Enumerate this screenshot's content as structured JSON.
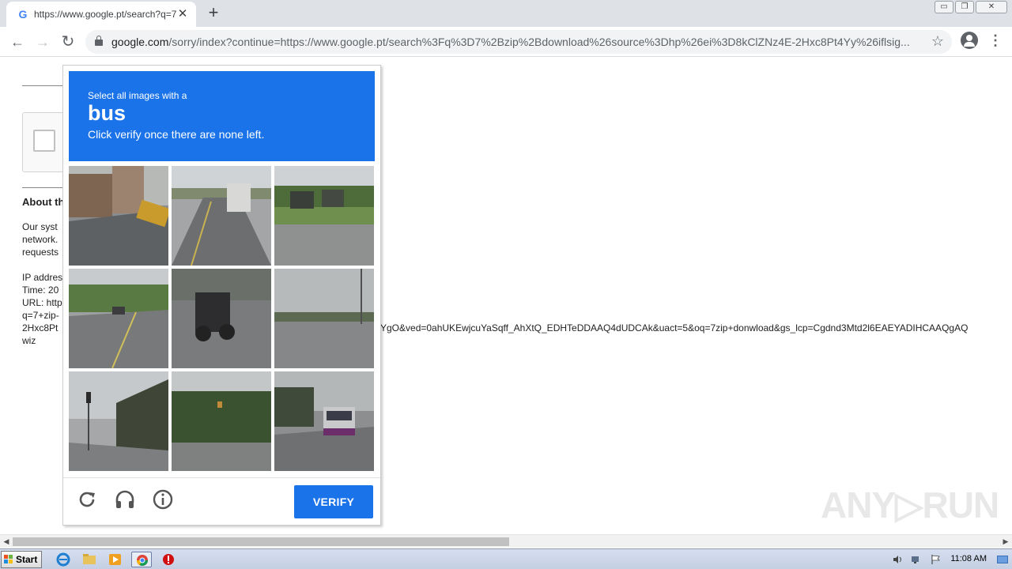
{
  "browser": {
    "tab_title": "https://www.google.pt/search?q=7",
    "tab_favicon": "G",
    "tab_close": "✕",
    "new_tab": "+",
    "win_minimize": "▭",
    "win_restore": "❐",
    "win_close": "✕",
    "back": "←",
    "forward": "→",
    "reload": "↻",
    "url_host": "google.com",
    "url_rest": "/sorry/index?continue=https://www.google.pt/search%3Fq%3D7%2Bzip%2Bdownload%26source%3Dhp%26ei%3D8kClZNz4E-2Hxc8Pt4Yy%26iflsig...",
    "star": "☆",
    "menu": "⋮"
  },
  "page": {
    "about_heading": "About th",
    "line1": "Our syst",
    "line2": "network.",
    "line3": "requests",
    "ip_label": "IP addres",
    "time_label": "Time: 20",
    "url_label": "URL: http",
    "url_q": "q=7+zip-",
    "url_cont": "2Hxc8Pt",
    "url_right": "YgO&ved=0ahUKEwjcuYaSqff_AhXtQ_EDHTeDDAAQ4dUDCAk&uact=5&oq=7zip+donwload&gs_lcp=Cgdnd3Mtd2l6EAEYADIHCAAQgAQ",
    "wiz": "wiz"
  },
  "captcha": {
    "desc1": "Select all images with a",
    "target": "bus",
    "desc2": "Click verify once there are none left.",
    "verify_label": "VERIFY",
    "header_color": "#1a73e8",
    "tiles": [
      {
        "name": "tile-1"
      },
      {
        "name": "tile-2"
      },
      {
        "name": "tile-3"
      },
      {
        "name": "tile-4"
      },
      {
        "name": "tile-5"
      },
      {
        "name": "tile-6"
      },
      {
        "name": "tile-7"
      },
      {
        "name": "tile-8"
      },
      {
        "name": "tile-9"
      }
    ]
  },
  "watermark": "ANY▷RUN",
  "taskbar": {
    "start_label": "Start",
    "clock": "11:08 AM"
  }
}
